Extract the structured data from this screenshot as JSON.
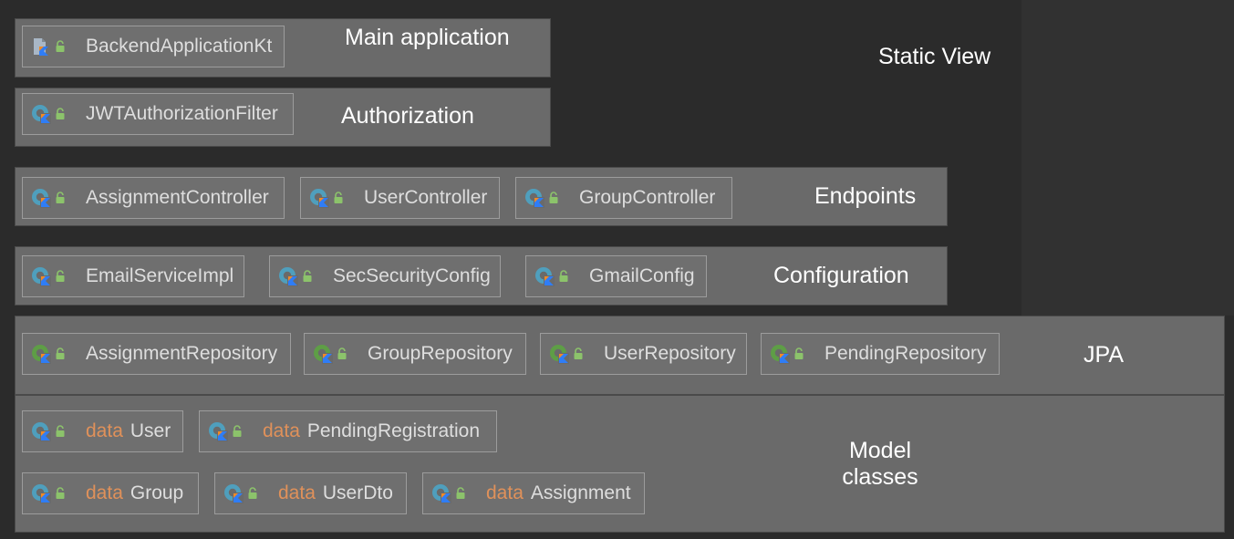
{
  "title": "Static View",
  "layers": [
    {
      "label": "Main application",
      "classes": [
        {
          "name": "BackendApplicationKt",
          "icon": "kotlin-file-icon"
        }
      ]
    },
    {
      "label": "Authorization",
      "classes": [
        {
          "name": "JWTAuthorizationFilter",
          "icon": "kotlin-class-icon"
        }
      ]
    },
    {
      "label": "Endpoints",
      "classes": [
        {
          "name": "AssignmentController",
          "icon": "kotlin-class-icon"
        },
        {
          "name": "UserController",
          "icon": "kotlin-class-icon"
        },
        {
          "name": "GroupController",
          "icon": "kotlin-class-icon"
        }
      ]
    },
    {
      "label": "Configuration",
      "classes": [
        {
          "name": "EmailServiceImpl",
          "icon": "kotlin-class-icon"
        },
        {
          "name": "SecSecurityConfig",
          "icon": "kotlin-class-icon"
        },
        {
          "name": "GmailConfig",
          "icon": "kotlin-class-icon"
        }
      ]
    },
    {
      "label": "JPA",
      "classes": [
        {
          "name": "AssignmentRepository",
          "icon": "kotlin-interface-icon"
        },
        {
          "name": "GroupRepository",
          "icon": "kotlin-interface-icon"
        },
        {
          "name": "UserRepository",
          "icon": "kotlin-interface-icon"
        },
        {
          "name": "PendingRepository",
          "icon": "kotlin-interface-icon"
        }
      ]
    },
    {
      "label": "Model\nclasses",
      "keyword": "data",
      "classes": [
        {
          "name": "User",
          "icon": "kotlin-class-icon"
        },
        {
          "name": "PendingRegistration",
          "icon": "kotlin-class-icon"
        },
        {
          "name": "Group",
          "icon": "kotlin-class-icon"
        },
        {
          "name": "UserDto",
          "icon": "kotlin-class-icon"
        },
        {
          "name": "Assignment",
          "icon": "kotlin-class-icon"
        }
      ]
    }
  ],
  "colors": {
    "background": "#2b2b2b",
    "panel": "#6a6a6a",
    "chip_text": "#dedede",
    "keyword": "#e0915a",
    "class_icon": "#4f9fbd",
    "interface_icon": "#5e9e46",
    "kotlin_mark_blue": "#2f7df6",
    "kotlin_mark_orange": "#f08a24",
    "lock": "#8cc36b"
  }
}
